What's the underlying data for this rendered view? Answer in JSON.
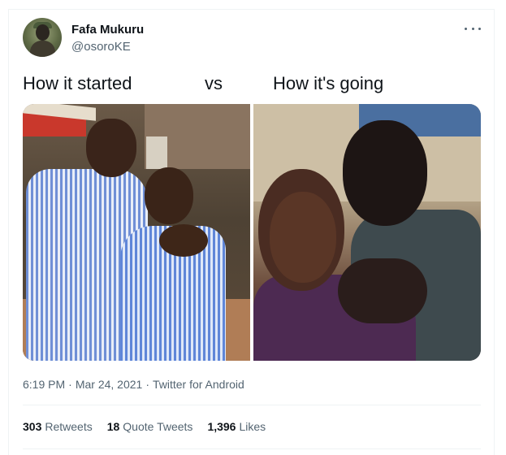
{
  "author": {
    "display_name": "Fafa Mukuru",
    "handle": "@osoroKE"
  },
  "tweet": {
    "text_left": "How it started",
    "text_vs": "vs",
    "text_right": "How it's going"
  },
  "media": {
    "left_photo": "couple-photo-started",
    "right_photo": "couple-photo-going"
  },
  "meta": {
    "time": "6:19 PM",
    "date": "Mar 24, 2021",
    "source": "Twitter for Android",
    "separator": "·"
  },
  "stats": {
    "retweets_count": "303",
    "retweets_label": "Retweets",
    "quote_count": "18",
    "quote_label": "Quote Tweets",
    "likes_count": "1,396",
    "likes_label": "Likes"
  },
  "icons": {
    "more": "more-options-icon"
  },
  "colors": {
    "text_primary": "#0f1419",
    "text_secondary": "#536471",
    "border": "#eff3f4"
  }
}
